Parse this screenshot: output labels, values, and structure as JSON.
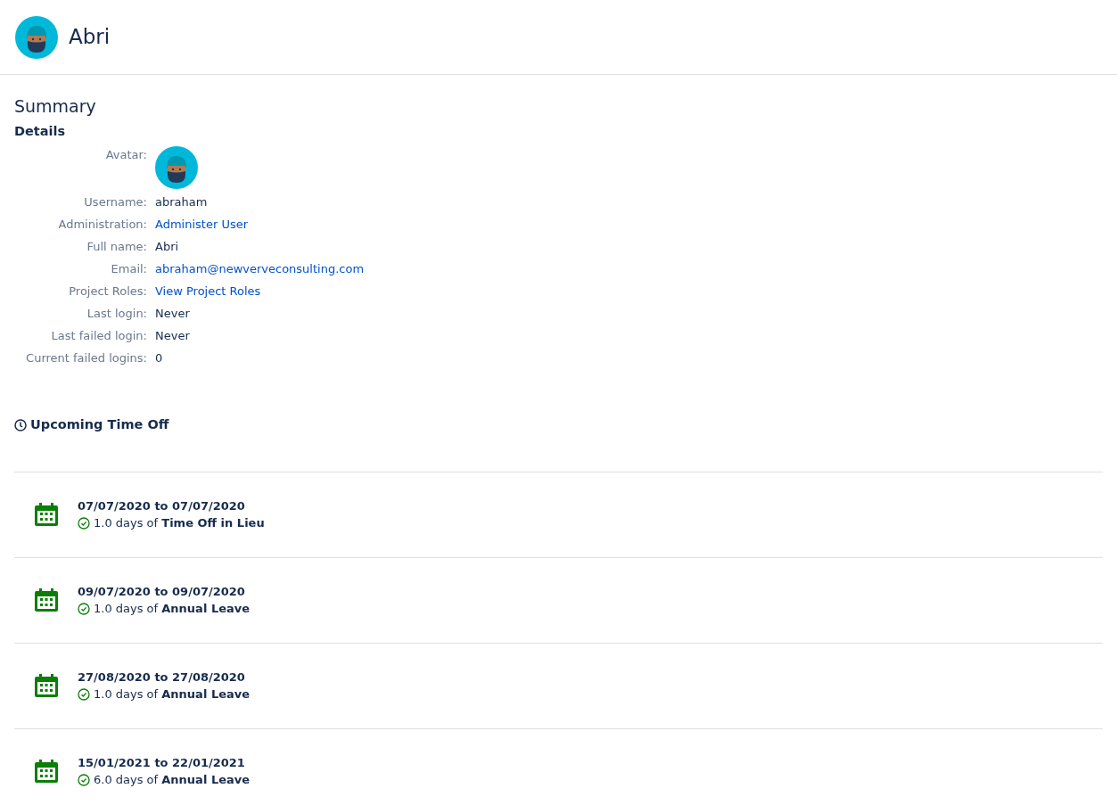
{
  "header": {
    "title": "Abri"
  },
  "summary": {
    "title": "Summary",
    "subtitle": "Details",
    "fields": [
      {
        "kind": "avatar",
        "label": "Avatar:"
      },
      {
        "kind": "text",
        "label": "Username:",
        "value": "abraham"
      },
      {
        "kind": "link",
        "label": "Administration:",
        "value": "Administer User"
      },
      {
        "kind": "text",
        "label": "Full name:",
        "value": "Abri"
      },
      {
        "kind": "link",
        "label": "Email:",
        "value": "abraham@newverveconsulting.com"
      },
      {
        "kind": "link",
        "label": "Project Roles:",
        "value": "View Project Roles"
      },
      {
        "kind": "text",
        "label": "Last login:",
        "value": "Never"
      },
      {
        "kind": "text",
        "label": "Last failed login:",
        "value": "Never"
      },
      {
        "kind": "text",
        "label": "Current failed logins:",
        "value": "0"
      }
    ]
  },
  "time_off": {
    "title": "Upcoming Time Off",
    "items": [
      {
        "dates": "07/07/2020 to 07/07/2020",
        "approved": true,
        "summary": "1.0 days of **Time Off in Lieu**"
      },
      {
        "dates": "09/07/2020 to 09/07/2020",
        "approved": true,
        "summary": "1.0 days of **Annual Leave**"
      },
      {
        "dates": "27/08/2020 to 27/08/2020",
        "approved": true,
        "summary": "1.0 days of **Annual Leave**"
      },
      {
        "dates": "15/01/2021 to 22/01/2021",
        "approved": true,
        "summary": "6.0 days of **Annual Leave**"
      }
    ]
  }
}
